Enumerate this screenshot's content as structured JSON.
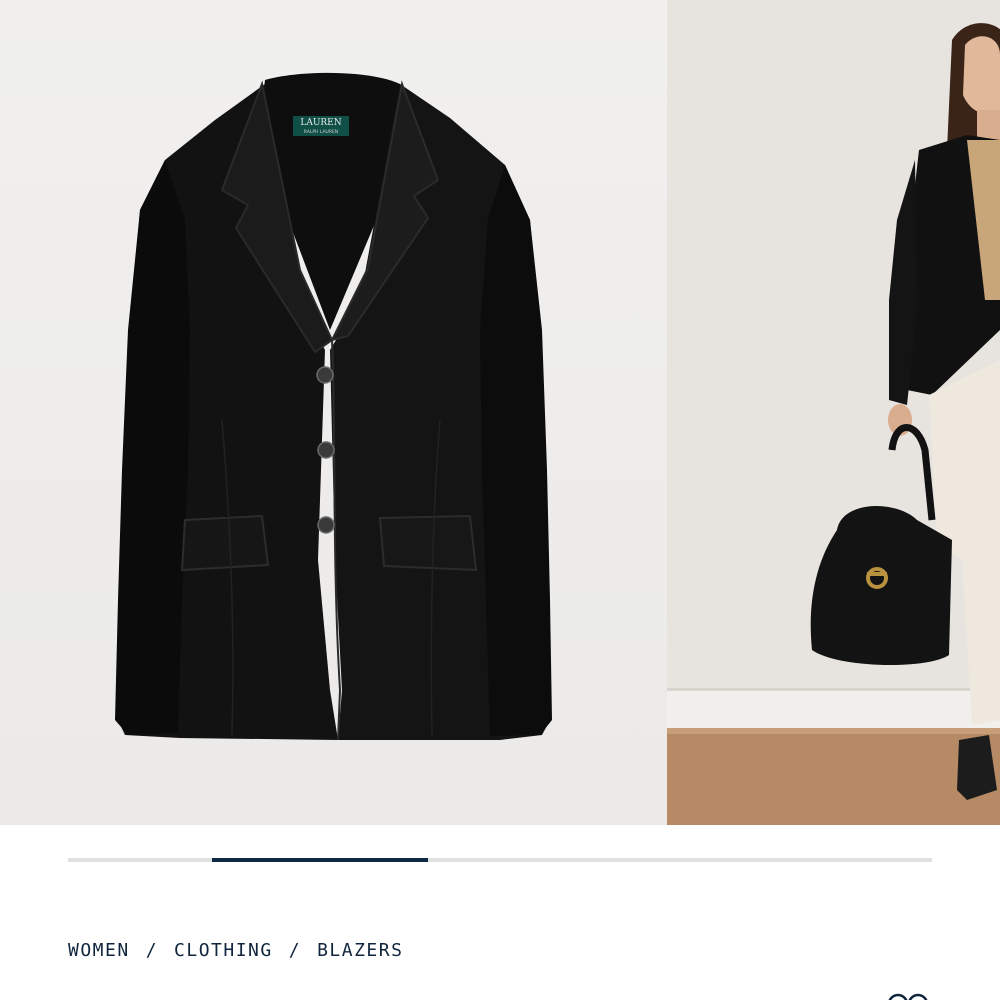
{
  "product_images": {
    "main": {
      "name": "black-blazer-product-photo",
      "label_text": "LAUREN",
      "label_subtext": "RALPH LAUREN"
    },
    "secondary": {
      "name": "model-wearing-blazer-photo"
    }
  },
  "carousel": {
    "position_fraction": 0.25,
    "visible_fraction": 0.25
  },
  "breadcrumb": {
    "items": [
      "WOMEN",
      "CLOTHING",
      "BLAZERS"
    ],
    "separator": "/"
  },
  "colors": {
    "accent": "#0f2a44",
    "track": "#dfe1e3",
    "text": "#10253d"
  },
  "icons": {
    "corner": "glasses-icon"
  }
}
